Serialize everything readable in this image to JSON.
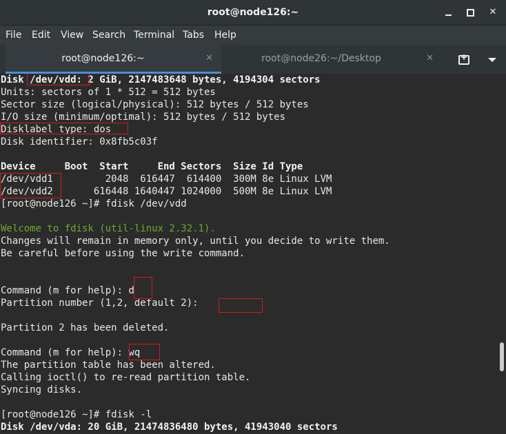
{
  "window": {
    "title": "root@node126:~"
  },
  "menu": [
    "File",
    "Edit",
    "View",
    "Search",
    "Terminal",
    "Tabs",
    "Help"
  ],
  "tabs": [
    {
      "label": "root@node126:~",
      "active": true
    },
    {
      "label": "root@node26:~/Desktop",
      "active": false
    }
  ],
  "terminal": {
    "lines": [
      {
        "text": "Disk /dev/vdd: 2 GiB, 2147483648 bytes, 4194304 sectors",
        "style": "bold"
      },
      {
        "text": "Units: sectors of 1 * 512 = 512 bytes",
        "style": "normal"
      },
      {
        "text": "Sector size (logical/physical): 512 bytes / 512 bytes",
        "style": "normal"
      },
      {
        "text": "I/O size (minimum/optimal): 512 bytes / 512 bytes",
        "style": "normal"
      },
      {
        "text": "Disklabel type: dos",
        "style": "normal"
      },
      {
        "text": "Disk identifier: 0x8fb5c03f",
        "style": "normal"
      },
      {
        "text": "",
        "style": "normal"
      },
      {
        "text": "Device     Boot  Start     End Sectors  Size Id Type",
        "style": "bold"
      },
      {
        "text": "/dev/vdd1         2048  616447  614400  300M 8e Linux LVM",
        "style": "normal"
      },
      {
        "text": "/dev/vdd2       616448 1640447 1024000  500M 8e Linux LVM",
        "style": "normal"
      },
      {
        "text": "[root@node126 ~]# fdisk /dev/vdd",
        "style": "normal"
      },
      {
        "text": "",
        "style": "normal"
      },
      {
        "text": "Welcome to fdisk (util-linux 2.32.1).",
        "style": "green"
      },
      {
        "text": "Changes will remain in memory only, until you decide to write them.",
        "style": "normal"
      },
      {
        "text": "Be careful before using the write command.",
        "style": "normal"
      },
      {
        "text": "",
        "style": "normal"
      },
      {
        "text": "",
        "style": "normal"
      },
      {
        "text": "Command (m for help): d",
        "style": "normal"
      },
      {
        "text": "Partition number (1,2, default 2): ",
        "style": "normal"
      },
      {
        "text": "",
        "style": "normal"
      },
      {
        "text": "Partition 2 has been deleted.",
        "style": "normal"
      },
      {
        "text": "",
        "style": "normal"
      },
      {
        "text": "Command (m for help): wq",
        "style": "normal"
      },
      {
        "text": "The partition table has been altered.",
        "style": "normal"
      },
      {
        "text": "Calling ioctl() to re-read partition table.",
        "style": "normal"
      },
      {
        "text": "Syncing disks.",
        "style": "normal"
      },
      {
        "text": "",
        "style": "normal"
      },
      {
        "text": "[root@node126 ~]# fdisk -l",
        "style": "normal"
      },
      {
        "text": "Disk /dev/vda: 20 GiB, 21474836480 bytes, 41943040 sectors",
        "style": "bold"
      }
    ]
  },
  "colors": {
    "background": "#2b2b2b",
    "text": "#e8e8e8",
    "green": "#6eaa2e",
    "highlight_box": "#d51b1b",
    "active_tab_underline": "#4a90d9"
  }
}
